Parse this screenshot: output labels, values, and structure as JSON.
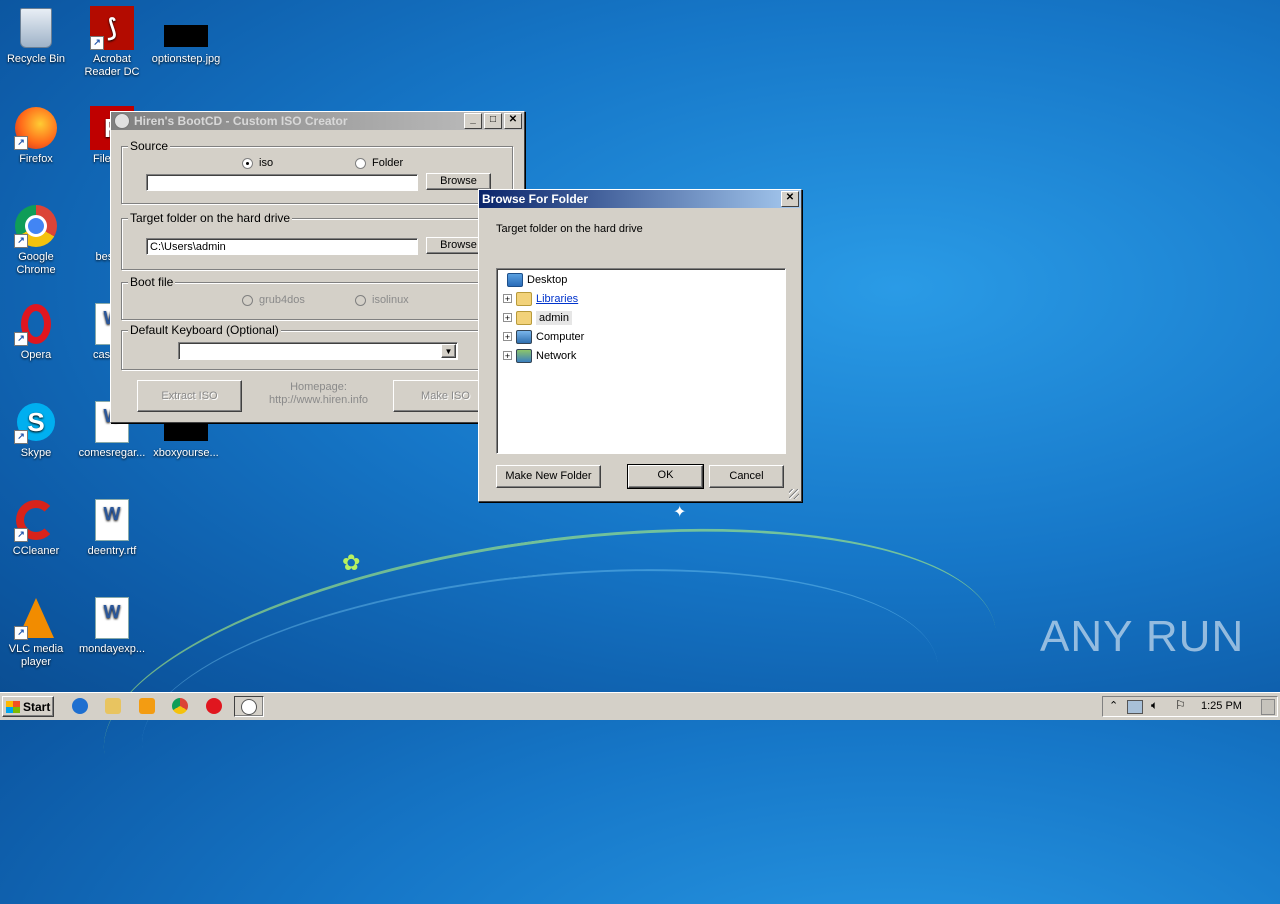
{
  "desktop": {
    "icons": [
      {
        "label": "Recycle Bin",
        "icon": "recycle-bin-icon"
      },
      {
        "label": "Acrobat Reader DC",
        "icon": "acrobat-icon"
      },
      {
        "label": "optionstep.jpg",
        "icon": "image-file-icon"
      },
      {
        "label": "Firefox",
        "icon": "firefox-icon"
      },
      {
        "label": "FileZilla",
        "icon": "filezilla-icon"
      },
      {
        "label": "Google Chrome",
        "icon": "chrome-icon"
      },
      {
        "label": "bestpo",
        "icon": "file-icon"
      },
      {
        "label": "Opera",
        "icon": "opera-icon"
      },
      {
        "label": "cashlea",
        "icon": "word-doc-icon"
      },
      {
        "label": "Skype",
        "icon": "skype-icon"
      },
      {
        "label": "comesregar...",
        "icon": "word-doc-icon"
      },
      {
        "label": "xboxyourse...",
        "icon": "image-file-icon"
      },
      {
        "label": "CCleaner",
        "icon": "ccleaner-icon"
      },
      {
        "label": "deentry.rtf",
        "icon": "word-doc-icon"
      },
      {
        "label": "VLC media player",
        "icon": "vlc-icon"
      },
      {
        "label": "mondayexp...",
        "icon": "word-doc-icon"
      }
    ]
  },
  "hiren": {
    "title": "Hiren's BootCD - Custom ISO Creator",
    "source": {
      "label": "Source",
      "option_iso": "iso",
      "option_folder": "Folder",
      "path": "",
      "browse": "Browse"
    },
    "target": {
      "label": "Target folder on the hard drive",
      "path": "C:\\Users\\admin",
      "browse": "Browse"
    },
    "boot": {
      "label": "Boot file",
      "option_grub": "grub4dos",
      "option_isolinux": "isolinux"
    },
    "keyboard": {
      "label": "Default Keyboard (Optional)",
      "value": ""
    },
    "extract_button": "Extract ISO",
    "homepage_label": "Homepage:",
    "homepage_url": "http://www.hiren.info",
    "make_button": "Make ISO"
  },
  "browse_dialog": {
    "title": "Browse For Folder",
    "instruction": "Target folder on the hard drive",
    "tree": [
      {
        "label": "Desktop",
        "icon": "desktop-icon"
      },
      {
        "label": "Libraries",
        "icon": "libraries-icon"
      },
      {
        "label": "admin",
        "icon": "user-folder-icon"
      },
      {
        "label": "Computer",
        "icon": "computer-icon"
      },
      {
        "label": "Network",
        "icon": "network-icon"
      }
    ],
    "make_new_folder": "Make New Folder",
    "ok": "OK",
    "cancel": "Cancel"
  },
  "taskbar": {
    "start": "Start",
    "clock": "1:25 PM"
  },
  "watermark": "ANY RUN",
  "colors": {
    "desktop_blue": "#1677c8",
    "title_active": "#0a246a",
    "dialog_gray": "#d4d0c8"
  }
}
